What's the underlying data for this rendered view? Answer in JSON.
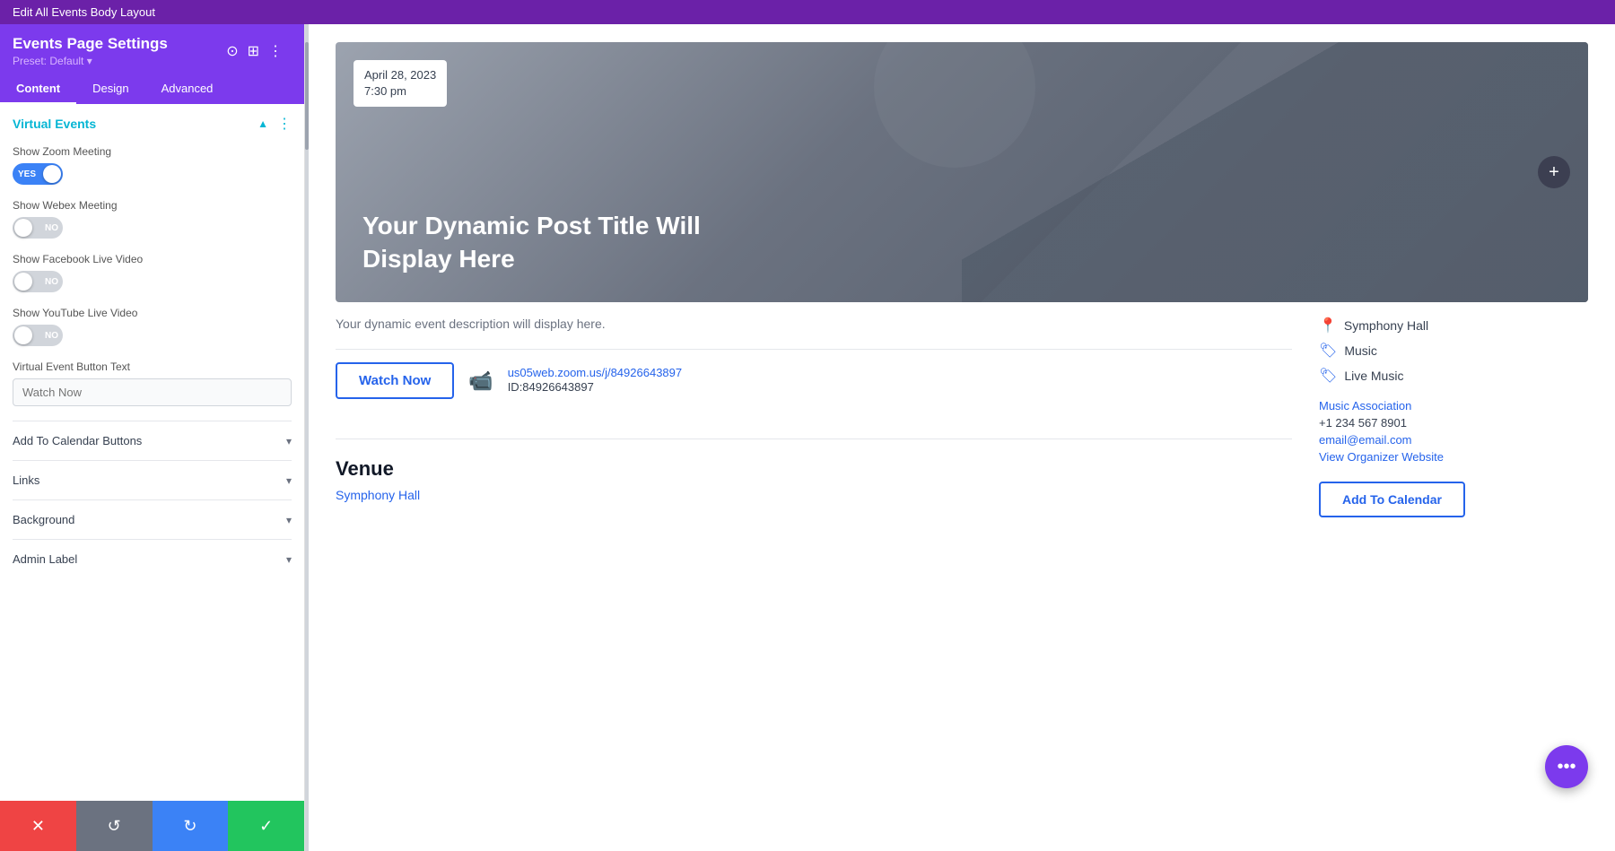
{
  "topbar": {
    "title": "Edit All Events Body Layout"
  },
  "sidebar": {
    "title": "Events Page Settings",
    "preset": "Preset: Default ▾",
    "tabs": [
      {
        "label": "Content",
        "active": true
      },
      {
        "label": "Design",
        "active": false
      },
      {
        "label": "Advanced",
        "active": false
      }
    ],
    "virtual_events": {
      "section_title": "Virtual Events",
      "show_zoom_meeting": {
        "label": "Show Zoom Meeting",
        "value": true,
        "yes_label": "YES",
        "no_label": "NO"
      },
      "show_webex_meeting": {
        "label": "Show Webex Meeting",
        "value": false,
        "no_label": "NO"
      },
      "show_facebook_live": {
        "label": "Show Facebook Live Video",
        "value": false,
        "no_label": "NO"
      },
      "show_youtube_live": {
        "label": "Show YouTube Live Video",
        "value": false,
        "no_label": "NO"
      },
      "virtual_button_text": {
        "label": "Virtual Event Button Text",
        "placeholder": "Watch Now"
      }
    },
    "collapsibles": [
      {
        "label": "Add To Calendar Buttons"
      },
      {
        "label": "Links"
      },
      {
        "label": "Background"
      },
      {
        "label": "Admin Label"
      }
    ],
    "footer_buttons": [
      {
        "label": "✕",
        "color": "red",
        "name": "cancel-button"
      },
      {
        "label": "↺",
        "color": "gray",
        "name": "undo-button"
      },
      {
        "label": "↻",
        "color": "blue",
        "name": "redo-button"
      },
      {
        "label": "✓",
        "color": "green",
        "name": "save-button"
      }
    ]
  },
  "hero": {
    "date_line1": "April 28, 2023",
    "date_line2": "7:30 pm",
    "title": "Your Dynamic Post Title Will Display Here"
  },
  "event": {
    "description": "Your dynamic event description will display here.",
    "watch_now_label": "Watch Now",
    "zoom_link": "us05web.zoom.us/j/84926643897",
    "zoom_id": "ID:84926643897",
    "venue_title": "Venue",
    "venue_link": "Symphony Hall",
    "location": "Symphony Hall",
    "tags": [
      "Music",
      "Live Music"
    ],
    "organizer": {
      "name": "Music Association",
      "phone": "+1 234 567 8901",
      "email": "email@email.com",
      "website_label": "View Organizer Website"
    },
    "add_calendar_label": "Add To Calendar"
  }
}
